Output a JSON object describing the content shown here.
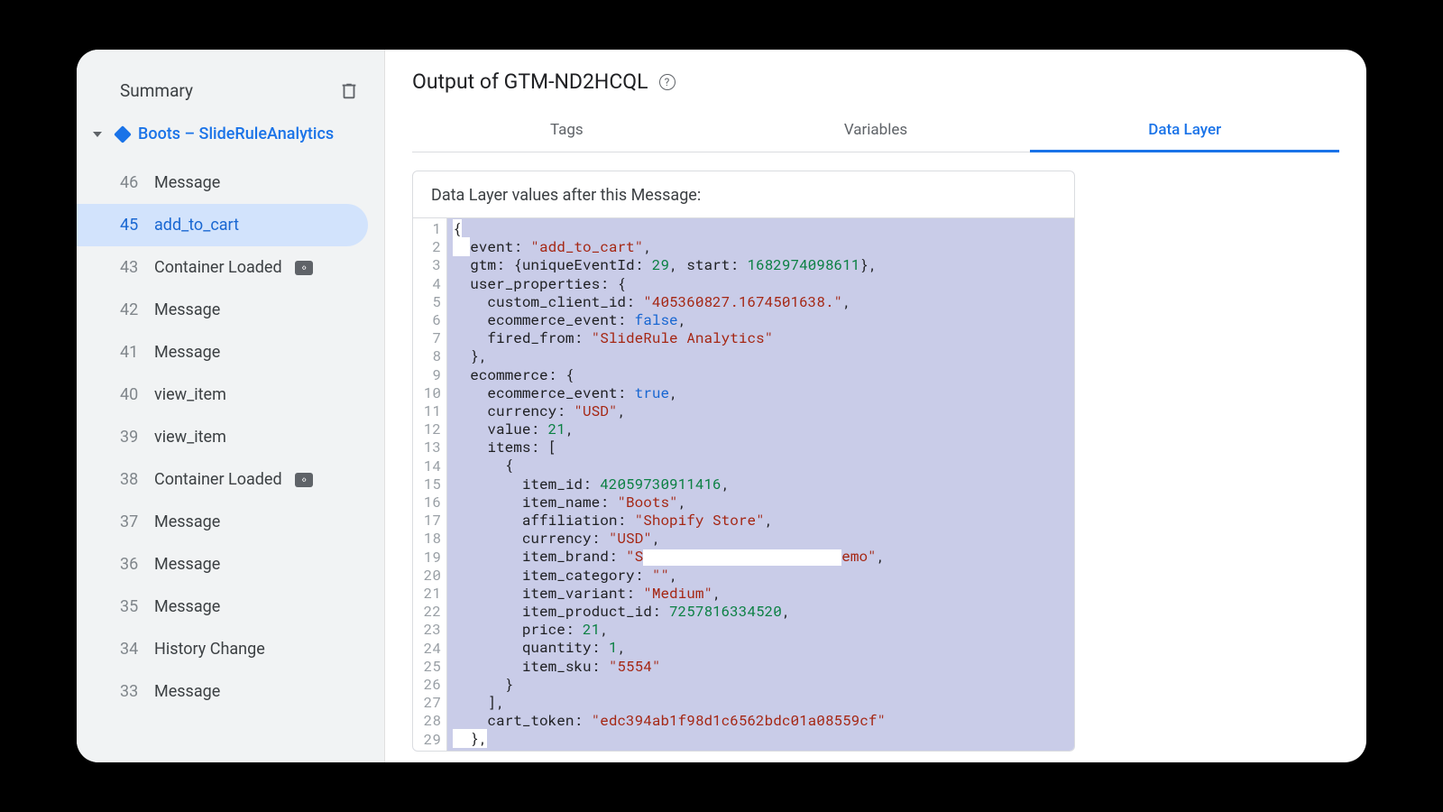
{
  "sidebar": {
    "title": "Summary",
    "root_label": "Boots – SlideRuleAnalytics",
    "events": [
      {
        "idx": "46",
        "label": "Message",
        "badge": false
      },
      {
        "idx": "45",
        "label": "add_to_cart",
        "badge": false,
        "active": true
      },
      {
        "idx": "43",
        "label": "Container Loaded",
        "badge": true
      },
      {
        "idx": "42",
        "label": "Message",
        "badge": false
      },
      {
        "idx": "41",
        "label": "Message",
        "badge": false
      },
      {
        "idx": "40",
        "label": "view_item",
        "badge": false
      },
      {
        "idx": "39",
        "label": "view_item",
        "badge": false
      },
      {
        "idx": "38",
        "label": "Container Loaded",
        "badge": true
      },
      {
        "idx": "37",
        "label": "Message",
        "badge": false
      },
      {
        "idx": "36",
        "label": "Message",
        "badge": false
      },
      {
        "idx": "35",
        "label": "Message",
        "badge": false
      },
      {
        "idx": "34",
        "label": "History Change",
        "badge": false
      },
      {
        "idx": "33",
        "label": "Message",
        "badge": false
      }
    ]
  },
  "header": {
    "title": "Output of GTM-ND2HCQL"
  },
  "tabs": [
    {
      "label": "Tags"
    },
    {
      "label": "Variables"
    },
    {
      "label": "Data Layer",
      "active": true
    }
  ],
  "panel": {
    "title": "Data Layer values after this Message:"
  },
  "data_layer": {
    "event": "add_to_cart",
    "gtm": {
      "uniqueEventId": 29,
      "start": 1682974098611
    },
    "user_properties": {
      "custom_client_id": "405360827.1674501638.",
      "ecommerce_event": false,
      "fired_from": "SlideRule Analytics"
    },
    "ecommerce": {
      "ecommerce_event": true,
      "currency": "USD",
      "value": 21,
      "items": [
        {
          "item_id": 42059730911416,
          "item_name": "Boots",
          "affiliation": "Shopify Store",
          "currency": "USD",
          "item_brand_prefix": "S",
          "item_brand_suffix": "emo",
          "item_category": "",
          "item_variant": "Medium",
          "item_product_id": 7257816334520,
          "price": 21,
          "quantity": 1,
          "item_sku": "5554"
        }
      ],
      "cart_token": "edc394ab1f98d1c6562bdc01a08559cf"
    }
  },
  "line_numbers": [
    "1",
    "2",
    "3",
    "4",
    "5",
    "6",
    "7",
    "8",
    "9",
    "10",
    "11",
    "12",
    "13",
    "14",
    "15",
    "16",
    "17",
    "18",
    "19",
    "20",
    "21",
    "22",
    "23",
    "24",
    "25",
    "26",
    "27",
    "28",
    "29"
  ]
}
